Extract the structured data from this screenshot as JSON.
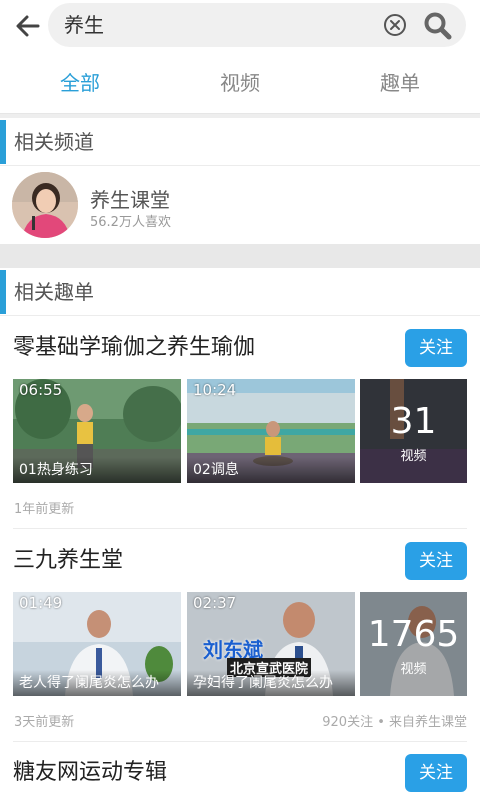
{
  "search": {
    "query": "养生"
  },
  "tabs": [
    {
      "label": "全部"
    },
    {
      "label": "视频"
    },
    {
      "label": "趣单"
    }
  ],
  "sections": {
    "channels": "相关频道",
    "playlists": "相关趣单"
  },
  "channel": {
    "name": "养生课堂",
    "likes": "56.2万人喜欢"
  },
  "playlists": [
    {
      "title": "零基础学瑜伽之养生瑜伽",
      "follow_label": "关注",
      "videos": [
        {
          "duration": "06:55",
          "caption": "01热身练习"
        },
        {
          "duration": "10:24",
          "caption": "02调息"
        }
      ],
      "more_count": "31",
      "more_unit": "视频",
      "updated": "1年前更新",
      "stats": ""
    },
    {
      "title": "三九养生堂",
      "follow_label": "关注",
      "videos": [
        {
          "duration": "01:49",
          "caption": "老人得了阑尾炎怎么办"
        },
        {
          "duration": "02:37",
          "caption": "孕妇得了阑尾炎怎么办",
          "overlay_name": "刘东斌",
          "overlay_place": "北京宣武医院"
        }
      ],
      "more_count": "1765",
      "more_unit": "视频",
      "updated": "3天前更新",
      "stats": "920关注 • 来自养生课堂"
    },
    {
      "title": "糖友网运动专辑",
      "follow_label": "关注"
    }
  ],
  "colors": {
    "accent": "#2a9fd8",
    "button": "#2aa0e6"
  }
}
